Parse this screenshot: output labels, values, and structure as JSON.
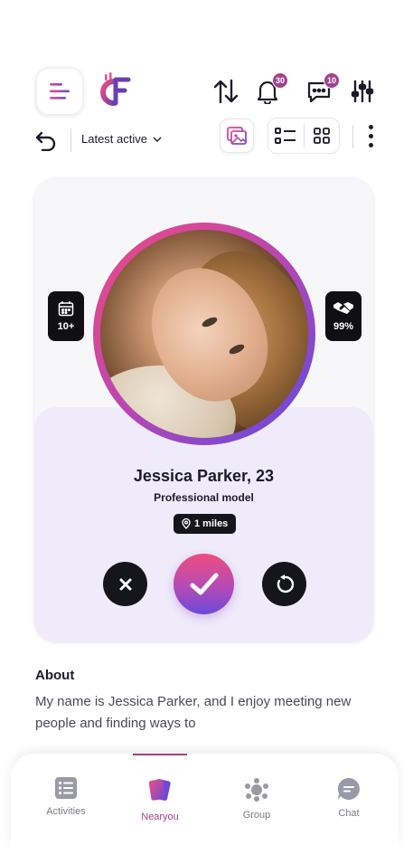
{
  "header": {
    "menu_icon": "menu-lines-icon",
    "logo_icon": "cf-logo-icon",
    "actions": [
      {
        "name": "swap-icon"
      },
      {
        "name": "bell-icon",
        "badge": "30"
      },
      {
        "name": "chat-bubble-icon",
        "badge": "10"
      },
      {
        "name": "sliders-icon"
      }
    ]
  },
  "toolbar": {
    "back_icon": "undo-arrow-icon",
    "sort_label": "Latest active",
    "sort_icon": "chevron-down-icon",
    "gallery_icon": "gallery-icon",
    "list_view_icon": "list-view-icon",
    "grid_view_icon": "grid-view-icon",
    "more_icon": "more-vertical-icon"
  },
  "profile": {
    "name": "Jessica Parker, 23",
    "role": "Professional model",
    "distance": "1 miles",
    "left_stat": {
      "icon": "calendar-icon",
      "value": "10+"
    },
    "right_stat": {
      "icon": "handshake-icon",
      "value": "99%"
    }
  },
  "actions": {
    "reject_icon": "close-icon",
    "like_icon": "check-icon",
    "rewind_icon": "rewind-icon"
  },
  "about": {
    "title": "About",
    "text": "My name is Jessica Parker, and I enjoy meeting new people and finding ways to"
  },
  "nav": {
    "items": [
      {
        "label": "Activities",
        "icon": "activities-icon",
        "active": false
      },
      {
        "label": "Nearyou",
        "icon": "cards-icon",
        "active": true
      },
      {
        "label": "Group",
        "icon": "group-icon",
        "active": false
      },
      {
        "label": "Chat",
        "icon": "chat-icon",
        "active": false
      }
    ]
  },
  "colors": {
    "accent": "#a0428f",
    "dark": "#15151c",
    "card_lower": "#efebfa",
    "gradient_start": "#ef4d7e",
    "gradient_end": "#6a4ad8"
  }
}
